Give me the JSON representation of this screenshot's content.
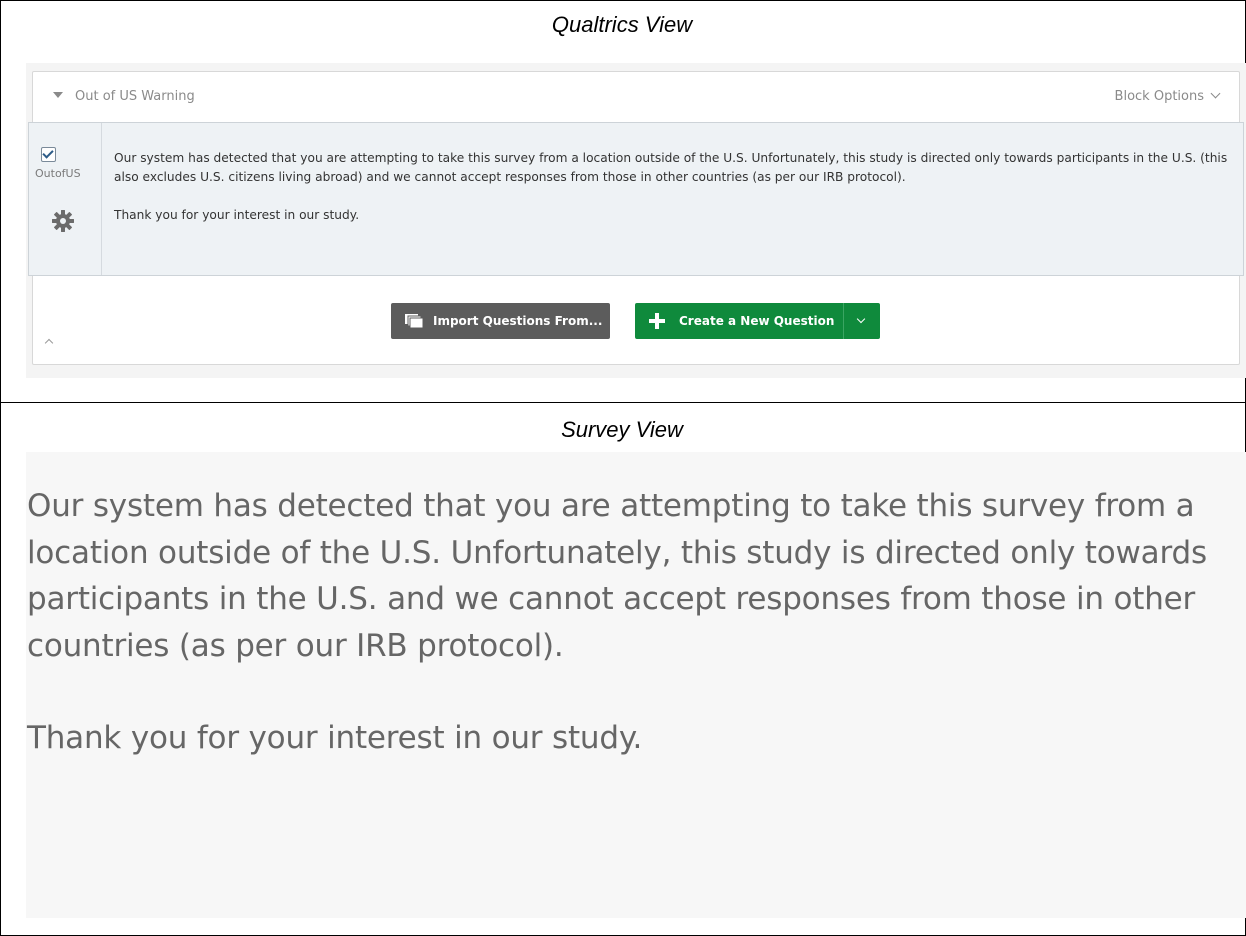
{
  "sections": {
    "qualtrics_title": "Qualtrics View",
    "survey_title": "Survey View"
  },
  "block": {
    "name": "Out of US Warning",
    "options_label": "Block Options"
  },
  "question": {
    "id": "OutofUS",
    "checked": true,
    "paragraph1": "Our system has detected that you are attempting to take this survey from a location outside of the U.S. Unfortunately, this study is directed only towards participants in the U.S. (this also excludes U.S. citizens living abroad) and we cannot accept responses from those in other countries (as per our IRB protocol).",
    "paragraph2": "Thank you for your interest in our study."
  },
  "buttons": {
    "import_label": "Import Questions From...",
    "create_label": "Create a New Question"
  },
  "survey": {
    "paragraph1": "Our system has detected that you are attempting to take this survey from a location outside of the U.S. Unfortunately, this study is directed only towards participants in the U.S. and we cannot accept responses from those in other countries (as per our IRB protocol).",
    "paragraph2": "Thank you for your interest in our study."
  },
  "colors": {
    "create_button": "#0f8a3c",
    "import_button": "#5c5c5c",
    "question_bg": "#eef2f5"
  },
  "icons": {
    "block_toggle": "caret-down-icon",
    "block_options": "chevron-down-icon",
    "question_settings": "gear-icon",
    "import": "copy-pages-icon",
    "create": "plus-icon",
    "collapse": "chevron-up-icon"
  }
}
